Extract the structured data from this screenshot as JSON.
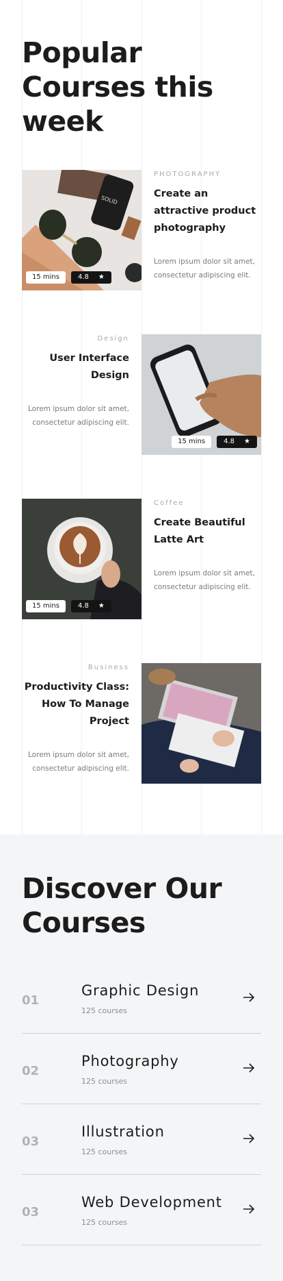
{
  "popular": {
    "title": "Popular Courses this week",
    "courses": [
      {
        "category": "PHOTOGRAPHY",
        "title": "Create an attractive product photography",
        "description": "Lorem ipsum dolor sit amet, consectetur adipiscing elit.",
        "duration": "15 mins",
        "rating": "4.8",
        "image": "sunglasses-flatlay-image"
      },
      {
        "category": "Design",
        "title": "User Interface Design",
        "description": "Lorem ipsum dolor sit amet, consectetur adipiscing elit.",
        "duration": "15 mins",
        "rating": "4.8",
        "image": "phone-in-hand-image"
      },
      {
        "category": "Coffee",
        "title": "Create Beautiful Latte Art",
        "description": "Lorem ipsum dolor sit amet, consectetur adipiscing elit.",
        "duration": "15 mins",
        "rating": "4.8",
        "image": "latte-art-image"
      },
      {
        "category": "Business",
        "title": "Productivity Class: How To Manage Project",
        "description": "Lorem ipsum dolor sit amet, consectetur adipiscing elit.",
        "image": "laptop-lap-image"
      }
    ]
  },
  "discover": {
    "title": "Discover Our Courses",
    "items": [
      {
        "number": "01",
        "name": "Graphic Design",
        "count": "125 courses"
      },
      {
        "number": "02",
        "name": "Photography",
        "count": "125 courses"
      },
      {
        "number": "03",
        "name": "Illustration",
        "count": "125 courses"
      },
      {
        "number": "03",
        "name": "Web Development",
        "count": "125 courses"
      }
    ]
  },
  "icons": {
    "rating": "star-icon",
    "link": "arrow-right-icon"
  },
  "colors": {
    "dark": "#1c1c1c",
    "muted": "#a9a9a9",
    "section_bg": "#f4f5f7",
    "badge_dark": "#141414"
  }
}
